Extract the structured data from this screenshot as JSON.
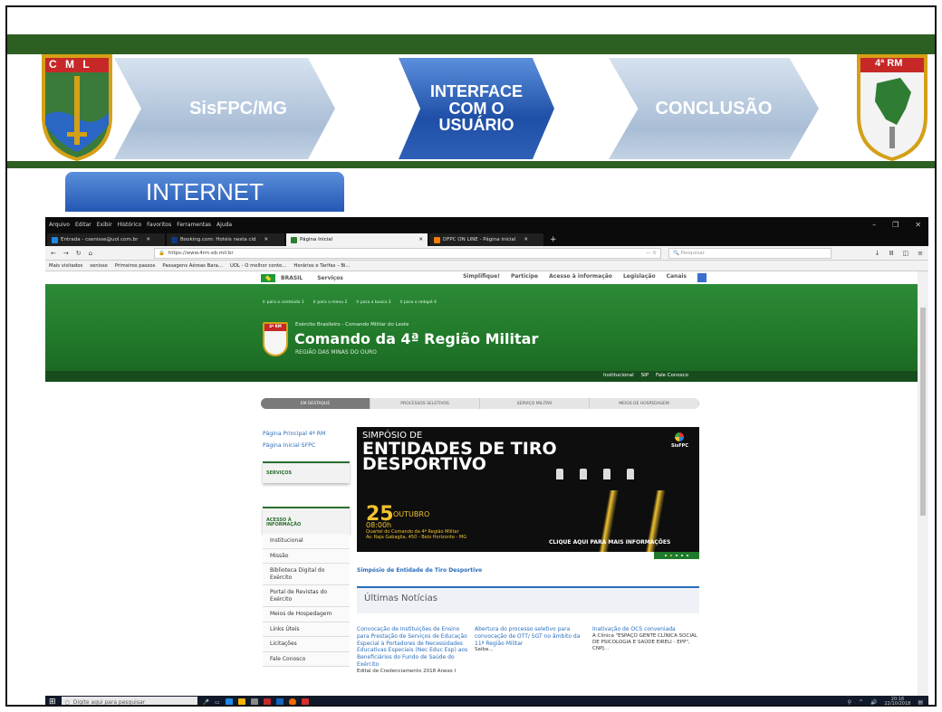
{
  "slide": {
    "left_crest_label": "C M L",
    "right_crest_label": "4ª RM",
    "chevrons": [
      "",
      "SisFPC/MG",
      "INTERFACE COM O USUÁRIO",
      "CONCLUSÃO"
    ],
    "section_tab": "INTERNET",
    "colors": {
      "green_bar": "#2e5f22",
      "active_chevron": "#1f4fa6",
      "inactive_chevron": "#a9bdd6"
    }
  },
  "browser": {
    "menu": [
      "Arquivo",
      "Editar",
      "Exibir",
      "Histórico",
      "Favoritos",
      "Ferramentas",
      "Ajuda"
    ],
    "tabs": [
      {
        "label": "Entrada - csenisse@uol.com.br",
        "active": false
      },
      {
        "label": "Booking.com: Hotéis nesta cid",
        "active": false
      },
      {
        "label": "Página Inicial",
        "active": true
      },
      {
        "label": "DFPC ON LINE - Página inicial",
        "active": false
      }
    ],
    "url": "https://www.4rm.eb.mil.br",
    "search_placeholder": "Pesquisar",
    "bookmarks": [
      "Mais visitados",
      "senisse",
      "Primeiros passos",
      "Passagens Aéreas Bara...",
      "UOL - O melhor conte...",
      "Horários e Tarifas – Bi..."
    ]
  },
  "site": {
    "gov_bar": {
      "brasil": "BRASIL",
      "servicos": "Serviços",
      "links": [
        "Simplifique!",
        "Participe",
        "Acesso à informação",
        "Legislação",
        "Canais"
      ]
    },
    "access_links": [
      "Ir para o conteúdo 1",
      "Ir para o menu 2",
      "Ir para a busca 3",
      "Ir para o rodapé 4"
    ],
    "army_line": "Exército Brasileiro - Comando Militar do Leste",
    "title": "Comando da 4ª Região Militar",
    "subtitle": "REGIÃO DAS MINAS DO OURO",
    "sub_nav": [
      "Institucional",
      "SIP",
      "Fale Conosco"
    ],
    "pills": [
      "EM DESTAQUE",
      "PROCESSOS SELETIVOS",
      "SERVIÇO MILITAR",
      "MEIOS DE HOSPEDAGEM"
    ],
    "left_links": [
      "Página Principal 4ª RM",
      "Página Inicial SFPC"
    ],
    "servicos": "SERVIÇOS",
    "acesso": [
      "ACESSO À",
      "INFORMAÇÃO"
    ],
    "left_nav": [
      "Institucional",
      "Missão",
      "Biblioteca Digital do Exército",
      "Portal de Revistas do Exército",
      "Meios de Hospedagem",
      "Links Úteis",
      "Licitações",
      "Fale Conosco"
    ],
    "promo": {
      "line1": "SIMPÓSIO DE",
      "line2": "ENTIDADES DE TIRO",
      "line3": "DESPORTIVO",
      "brand": "SisFPC",
      "day": "25",
      "month": "OUTUBRO",
      "hour": "08:00h",
      "place1": "Quartel do Comando da 4ª Região Militar",
      "place2": "Av. Raja Gabaglia, 450 - Belo Horizonte - MG",
      "cta": "CLIQUE AQUI PARA MAIS INFORMAÇÕES"
    },
    "caption": "Simpósio de Entidade de Tiro Desportivo",
    "news_title": "Últimas Notícias",
    "news": [
      {
        "title": "Convocação de Instituições de Ensino para Prestação de Serviços de Educação Especial à Portadores de Necessidades Educativas Especiais (Nec Educ Esp) aos Beneficiários do Fundo de Saúde do Exército",
        "sub": "Edital de Credenciamento 2018 Anexo I"
      },
      {
        "title": "Abertura do processo seletivo para convocação de OTT/ SGT no âmbito da 11ª Região Militar",
        "sub": "Saiba..."
      },
      {
        "title": "Inativação de OCS conveniada",
        "sub": "A Clínica \"ESPAÇO GENTE CLÍNICA SOCIAL DE PSICOLOGIA E SAÚDE EIRELI - EPP\", CNPJ..."
      }
    ]
  },
  "taskbar": {
    "search": "Digite aqui para pesquisar",
    "time": "20:18",
    "date": "22/10/2018"
  }
}
